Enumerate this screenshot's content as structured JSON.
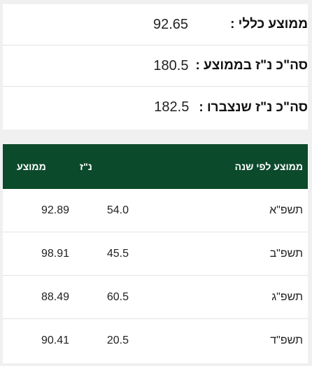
{
  "summary": {
    "overall_label": "ממוצע כללי :",
    "overall_value": "92.65",
    "credits_avg_label": "סה\"כ נ\"ז בממוצע :",
    "credits_avg_value": "180.5",
    "credits_total_label": "סה\"כ נ\"ז שנצברו :",
    "credits_total_value": "182.5"
  },
  "table": {
    "headers": {
      "year": "ממוצע לפי שנה",
      "credits": "נ\"ז",
      "average": "ממוצע"
    },
    "rows": [
      {
        "year": "תשפ\"א",
        "credits": "54.0",
        "average": "92.89"
      },
      {
        "year": "תשפ\"ב",
        "credits": "45.5",
        "average": "98.91"
      },
      {
        "year": "תשפ\"ג",
        "credits": "60.5",
        "average": "88.49"
      },
      {
        "year": "תשפ\"ד",
        "credits": "20.5",
        "average": "90.41"
      }
    ]
  },
  "colors": {
    "header_bg": "#0b4a2b",
    "page_bg": "#f0f0f0"
  }
}
